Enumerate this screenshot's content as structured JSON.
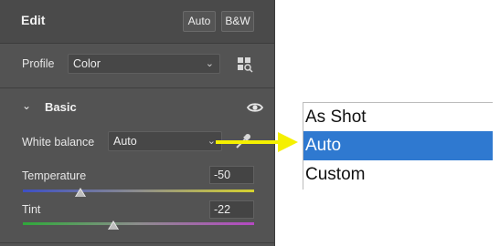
{
  "edit": {
    "title": "Edit",
    "auto_label": "Auto",
    "bw_label": "B&W"
  },
  "profile": {
    "label": "Profile",
    "value": "Color",
    "browser_icon": "profile-browser-grid-icon"
  },
  "basic": {
    "title": "Basic",
    "visibility_icon": "eye-icon",
    "white_balance": {
      "label": "White balance",
      "value": "Auto",
      "eyedropper_icon": "eyedropper-icon"
    },
    "temperature": {
      "label": "Temperature",
      "value": "-50",
      "slider_fraction": 0.25
    },
    "tint": {
      "label": "Tint",
      "value": "-22",
      "slider_fraction": 0.39
    }
  },
  "wb_menu": {
    "options": [
      "As Shot",
      "Auto",
      "Custom"
    ],
    "selected_index": 1,
    "selected_color": "#2f79d0"
  },
  "callout": {
    "arrow_color": "#f5f000"
  }
}
